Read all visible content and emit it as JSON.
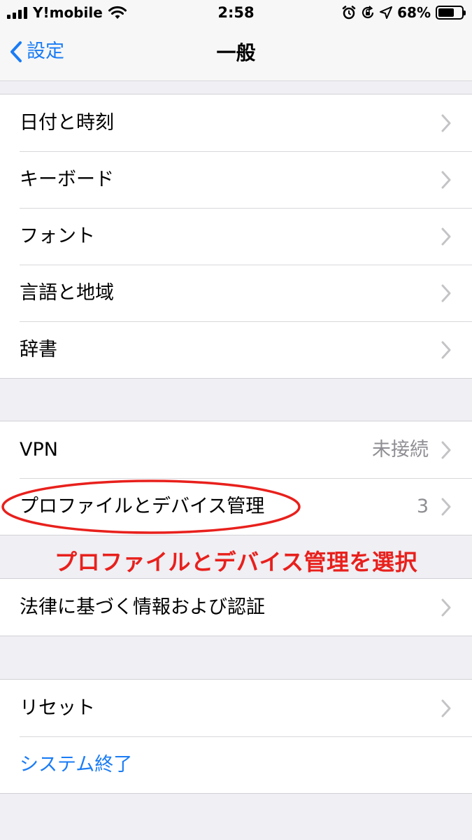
{
  "status_bar": {
    "carrier": "Y!mobile",
    "time": "2:58",
    "battery_percent": "68%",
    "battery_level": 0.68,
    "icons": [
      "signal-icon",
      "wifi-icon",
      "alarm-icon",
      "rotation-lock-icon",
      "location-arrow-icon",
      "battery-icon"
    ]
  },
  "nav": {
    "back_label": "設定",
    "title": "一般"
  },
  "groups": [
    {
      "rows": [
        {
          "label": "日付と時刻"
        },
        {
          "label": "キーボード"
        },
        {
          "label": "フォント"
        },
        {
          "label": "言語と地域"
        },
        {
          "label": "辞書"
        }
      ]
    },
    {
      "rows": [
        {
          "label": "VPN",
          "value": "未接続"
        },
        {
          "label": "プロファイルとデバイス管理",
          "value": "3"
        }
      ]
    },
    {
      "rows": [
        {
          "label": "法律に基づく情報および認証"
        }
      ]
    },
    {
      "rows": [
        {
          "label": "リセット"
        },
        {
          "label": "システム終了"
        }
      ]
    }
  ],
  "annotation": {
    "text": "プロファイルとデバイス管理を選択",
    "color": "#e8201c"
  },
  "colors": {
    "accent": "#1a7cf5",
    "background": "#efeff4",
    "secondary_text": "#8e8e93",
    "chevron": "#c4c4c7"
  }
}
